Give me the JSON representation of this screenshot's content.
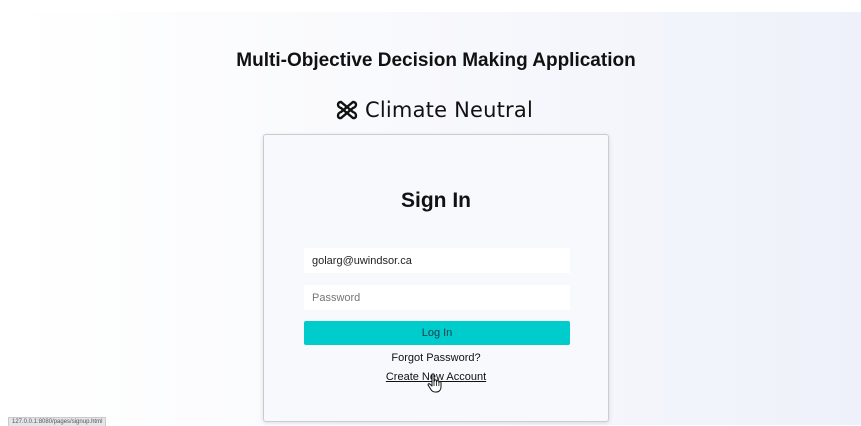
{
  "app": {
    "title": "Multi-Objective Decision Making Application",
    "brand_name": "Climate Neutral",
    "brand_icon": "climate-neutral-logo-icon"
  },
  "signin": {
    "title": "Sign In",
    "email_value": "golarg@uwindsor.ca",
    "email_placeholder": "",
    "password_value": "",
    "password_placeholder": "Password",
    "login_label": "Log In",
    "forgot_label": "Forgot Password?",
    "create_account_label": "Create New Account"
  },
  "status_bar": {
    "url": "127.0.0.1:8080/pages/signup.html"
  },
  "colors": {
    "accent": "#00cccc",
    "card_background": "#f8f9fc",
    "page_gradient_end": "#eef1fa"
  }
}
